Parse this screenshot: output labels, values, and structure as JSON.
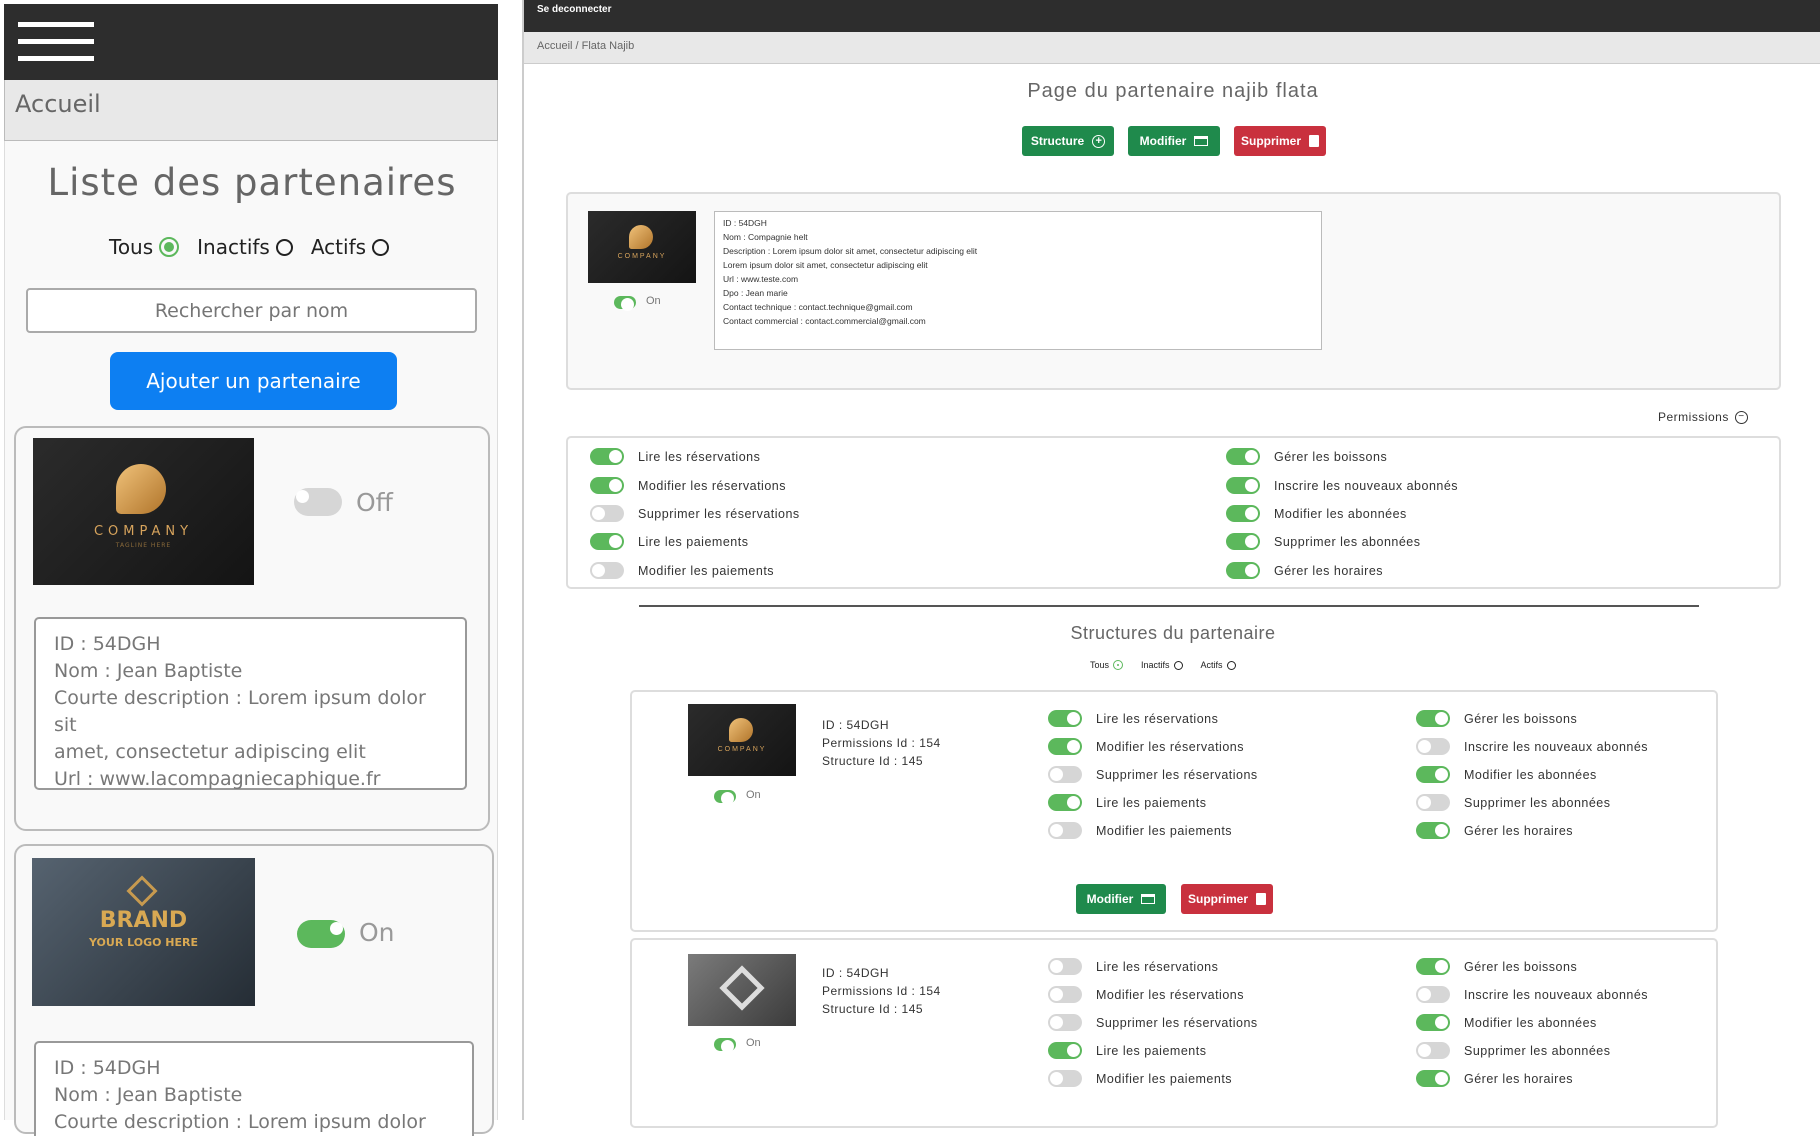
{
  "left": {
    "home_label": "Accueil",
    "title": "Liste des partenaires",
    "filters": [
      {
        "label": "Tous",
        "selected": true
      },
      {
        "label": "Inactifs",
        "selected": false
      },
      {
        "label": "Actifs",
        "selected": false
      }
    ],
    "search_placeholder": "Rechercher par nom",
    "add_button": "Ajouter un partenaire",
    "cards": [
      {
        "logo": {
          "name": "COMPANY",
          "tagline": "TAGLINE HERE"
        },
        "toggle": "Off",
        "lines": [
          "ID : 54DGH",
          "Nom : Jean Baptiste",
          "Courte description : Lorem ipsum dolor sit",
          "amet, consectetur adipiscing elit",
          "Url : www.lacompagniecaphique.fr"
        ]
      },
      {
        "logo": {
          "name": "BRAND",
          "tagline": "YOUR LOGO HERE"
        },
        "toggle": "On",
        "lines": [
          "ID : 54DGH",
          "Nom : Jean Baptiste",
          "Courte description : Lorem ipsum dolor sit"
        ]
      }
    ]
  },
  "right": {
    "topbar_link": "Se deconnecter",
    "breadcrumb": "Accueil / Flata Najib",
    "page_title": "Page du partenaire najib flata",
    "actions": {
      "structure": "Structure",
      "modify": "Modifier",
      "delete": "Supprimer"
    },
    "partner": {
      "logo": {
        "name": "COMPANY"
      },
      "toggle": "On",
      "info_lines": [
        "ID : 54DGH",
        "Nom : Compagnie helt",
        "Description : Lorem ipsum dolor sit amet, consectetur adipiscing elit",
        "Lorem ipsum dolor sit amet, consectetur adipiscing elit",
        "Url : www.teste.com",
        "Dpo : Jean marie",
        "Contact technique : contact.technique@gmail.com",
        "Contact commercial : contact.commercial@gmail.com"
      ]
    },
    "permissions_label": "Permissions",
    "permissions": {
      "left": [
        {
          "label": "Lire les réservations",
          "on": true
        },
        {
          "label": "Modifier les réservations",
          "on": true
        },
        {
          "label": "Supprimer les réservations",
          "on": false
        },
        {
          "label": "Lire les paiements",
          "on": true
        },
        {
          "label": "Modifier les paiements",
          "on": false
        }
      ],
      "right": [
        {
          "label": "Gérer les boissons",
          "on": true
        },
        {
          "label": "Inscrire les nouveaux abonnés",
          "on": true
        },
        {
          "label": "Modifier les abonnées",
          "on": true
        },
        {
          "label": "Supprimer les abonnées",
          "on": true
        },
        {
          "label": "Gérer les horaires",
          "on": true
        }
      ]
    },
    "structures_title": "Structures du partenaire",
    "structure_filters": [
      {
        "label": "Tous",
        "selected": true
      },
      {
        "label": "Inactifs",
        "selected": false
      },
      {
        "label": "Actifs",
        "selected": false
      }
    ],
    "structures": [
      {
        "logo": "COMPANY",
        "toggle": "On",
        "info": [
          "ID : 54DGH",
          "Permissions Id  : 154",
          "Structure Id : 145"
        ],
        "left": [
          {
            "label": "Lire les réservations",
            "on": true
          },
          {
            "label": "Modifier les réservations",
            "on": true
          },
          {
            "label": "Supprimer les réservations",
            "on": false
          },
          {
            "label": "Lire les paiements",
            "on": true
          },
          {
            "label": "Modifier les paiements",
            "on": false
          }
        ],
        "right": [
          {
            "label": "Gérer les boissons",
            "on": true
          },
          {
            "label": "Inscrire les nouveaux abonnés",
            "on": false
          },
          {
            "label": "Modifier les abonnées",
            "on": true
          },
          {
            "label": "Supprimer les abonnées",
            "on": false
          },
          {
            "label": "Gérer les horaires",
            "on": true
          }
        ],
        "modify": "Modifier",
        "delete": "Supprimer"
      },
      {
        "logo": "GRAY",
        "toggle": "On",
        "info": [
          "ID : 54DGH",
          "Permissions Id  : 154",
          "Structure Id : 145"
        ],
        "left": [
          {
            "label": "Lire les réservations",
            "on": false
          },
          {
            "label": "Modifier les réservations",
            "on": false
          },
          {
            "label": "Supprimer les réservations",
            "on": false
          },
          {
            "label": "Lire les paiements",
            "on": true
          },
          {
            "label": "Modifier les paiements",
            "on": false
          }
        ],
        "right": [
          {
            "label": "Gérer les boissons",
            "on": true
          },
          {
            "label": "Inscrire les nouveaux abonnés",
            "on": false
          },
          {
            "label": "Modifier les abonnées",
            "on": true
          },
          {
            "label": "Supprimer les abonnées",
            "on": false
          },
          {
            "label": "Gérer les horaires",
            "on": true
          }
        ]
      }
    ]
  },
  "colors": {
    "topbar": "#2d2d2d",
    "green": "#1f8a4c",
    "red": "#c9313e",
    "toggle_on": "#5cb85c",
    "primary": "#0d7ff2"
  }
}
